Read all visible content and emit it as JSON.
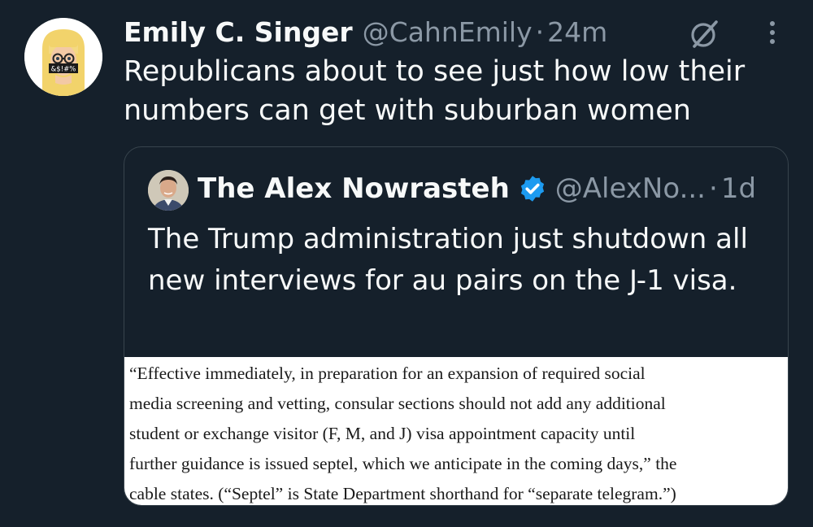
{
  "tweet": {
    "author_name": "Emily C. Singer",
    "author_handle": "@CahnEmily",
    "separator": "·",
    "time": "24m",
    "text": "Republicans about to see just how low their numbers can get with suburban women",
    "avatar_sign": "&$!#%"
  },
  "quote": {
    "author_name": "The Alex Nowrasteh",
    "author_handle": "@AlexNo...",
    "separator": "·",
    "time": "1d",
    "text": "The Trump administration just shutdown all new interviews for au pairs on the J-1 visa.",
    "image_text_lines": [
      "“Effective immediately, in preparation for an expansion of required social",
      "media screening and vetting, consular sections should not add any additional",
      "student or exchange visitor (F, M, and J) visa appointment capacity until",
      "further guidance is issued septel, which we anticipate in the coming days,” the",
      "cable states. (“Septel” is State Department shorthand for “separate telegram.”)"
    ]
  },
  "icons": {
    "grok": "grok-icon",
    "more": "more-icon",
    "verified": "verified-badge-icon"
  },
  "colors": {
    "background": "#15202b",
    "text_primary": "#f7f9f9",
    "text_secondary": "#8b98a5",
    "border": "#38444d",
    "verified_blue": "#1d9bf0"
  }
}
